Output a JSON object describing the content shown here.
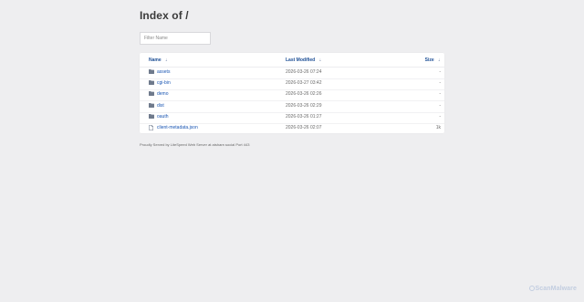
{
  "page": {
    "title": "Index of /",
    "filter_placeholder": "Filter Name",
    "columns": {
      "name": "Name",
      "last_modified": "Last Modified",
      "size": "Size"
    },
    "sort_indicator": "⇣",
    "entries": [
      {
        "name": "assets",
        "type": "folder",
        "modified": "2026-03-26 07:24",
        "size": "-"
      },
      {
        "name": "cgi-bin",
        "type": "folder",
        "modified": "2026-03-27 03:42",
        "size": "-"
      },
      {
        "name": "demo",
        "type": "folder",
        "modified": "2026-03-26 02:26",
        "size": "-"
      },
      {
        "name": "dist",
        "type": "folder",
        "modified": "2026-03-26 02:29",
        "size": "-"
      },
      {
        "name": "oauth",
        "type": "folder",
        "modified": "2026-03-26 01:27",
        "size": "-"
      },
      {
        "name": "client-metadata.json",
        "type": "file",
        "modified": "2026-03-26 02:07",
        "size": "1k"
      }
    ],
    "footer": "Proudly Served by LiteSpeed Web Server at atshare.social Port 443",
    "watermark": "ScanMalware"
  },
  "colors": {
    "background": "#eeeef0",
    "link": "#1a56b3",
    "header_link": "#1c4e95",
    "folder_icon": "#6f7a8c"
  }
}
